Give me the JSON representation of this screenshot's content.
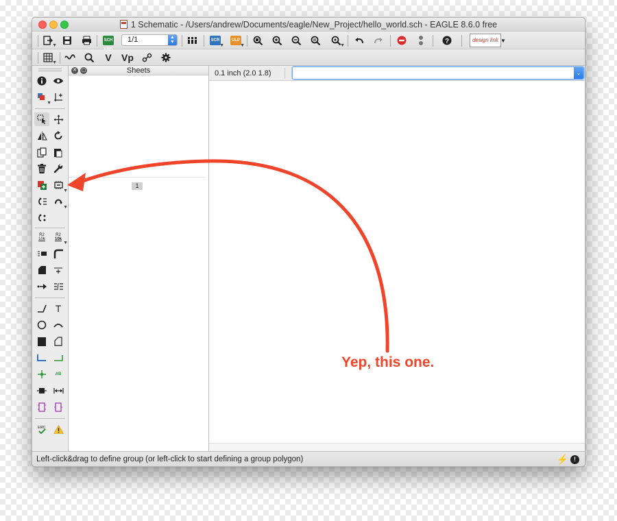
{
  "window": {
    "title": "1 Schematic - /Users/andrew/Documents/eagle/New_Project/hello_world.sch - EAGLE 8.6.0 free"
  },
  "toolbar": {
    "page_value": "1/1",
    "scr_label": "SCR",
    "ulp_label": "ULP",
    "sch_label": "SCH BRD",
    "designlink_label": "design link",
    "icons": [
      "open-icon",
      "save-icon",
      "print-icon",
      "sch-brd-icon",
      "page-select",
      "cam-icon",
      "script-icon",
      "ulp-icon",
      "zoom-fit-icon",
      "zoom-in-icon",
      "zoom-out-icon",
      "zoom-select-icon",
      "zoom-last-icon",
      "undo-icon",
      "redo-icon",
      "stop-icon",
      "go-icon",
      "help-icon",
      "designlink-icon"
    ]
  },
  "toolbar2": {
    "items": [
      {
        "name": "grid-icon",
        "label": "▦"
      },
      {
        "name": "ratsnest-icon",
        "label": "∿"
      },
      {
        "name": "show-icon",
        "label": "🔍"
      },
      {
        "name": "value-icon",
        "label": "V"
      },
      {
        "name": "vp-icon",
        "label": "Vp"
      },
      {
        "name": "net-class-icon",
        "label": "∂"
      },
      {
        "name": "settings-gear-icon",
        "label": "⚙"
      }
    ]
  },
  "sheets": {
    "title": "Sheets",
    "sheet_number": "1"
  },
  "workspace": {
    "coordinates": "0.1 inch (2.0 1.8)",
    "command_value": ""
  },
  "status": {
    "text": "Left-click&drag to define group (or left-click to start defining a group polygon)"
  },
  "annotation": {
    "text": "Yep, this one.",
    "color": "#f0452a"
  },
  "colors": {
    "accent_blue": "#2c7be8",
    "close_red": "#fc605c",
    "minimize_yellow": "#fdbc40",
    "zoom_green": "#34c84a"
  }
}
